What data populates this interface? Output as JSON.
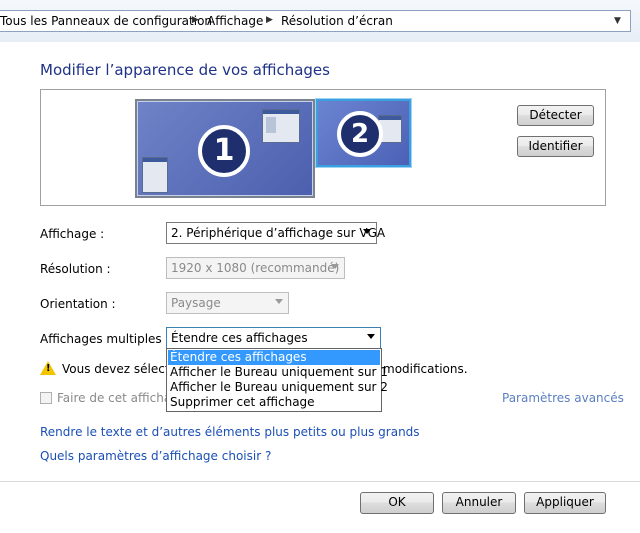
{
  "breadcrumb": {
    "items": [
      "Tous les Panneaux de configuration",
      "Affichage",
      "Résolution d’écran"
    ],
    "separator": "▶",
    "dropdown_icon": "chevron-down-icon"
  },
  "title": "Modifier l’apparence de vos affichages",
  "monitors": {
    "one": "1",
    "two": "2",
    "detect_label": "Détecter",
    "identify_label": "Identifier"
  },
  "form": {
    "display_label": "Affichage :",
    "display_value": "2. Périphérique d’affichage sur VGA",
    "resolution_label": "Résolution :",
    "resolution_value": "1920 x 1080 (recommandé)",
    "orientation_label": "Orientation :",
    "orientation_value": "Paysage",
    "multiple_label": "Affichages multiples :",
    "multiple_value": "Étendre ces affichages"
  },
  "dropdown": {
    "options": [
      "Étendre ces affichages",
      "Afficher le Bureau uniquement sur 1",
      "Afficher le Bureau uniquement sur 2",
      "Supprimer cet affichage"
    ],
    "selected_index": 0
  },
  "warning": {
    "text_left": "Vous devez sélection",
    "text_right": "modifications.",
    "icon": "warning-icon"
  },
  "checkbox_label": "Faire de cet affichage",
  "advanced_link": "Paramètres avancés",
  "links": {
    "text_size": "Rendre le texte et d’autres éléments plus petits ou plus grands",
    "which_settings": "Quels paramètres d’affichage choisir ?"
  },
  "footer": {
    "ok": "OK",
    "cancel": "Annuler",
    "apply": "Appliquer"
  },
  "colors": {
    "title": "#1e3287",
    "link": "#1a4fb5",
    "selection": "#3399ff",
    "warning": "#f2c500"
  }
}
